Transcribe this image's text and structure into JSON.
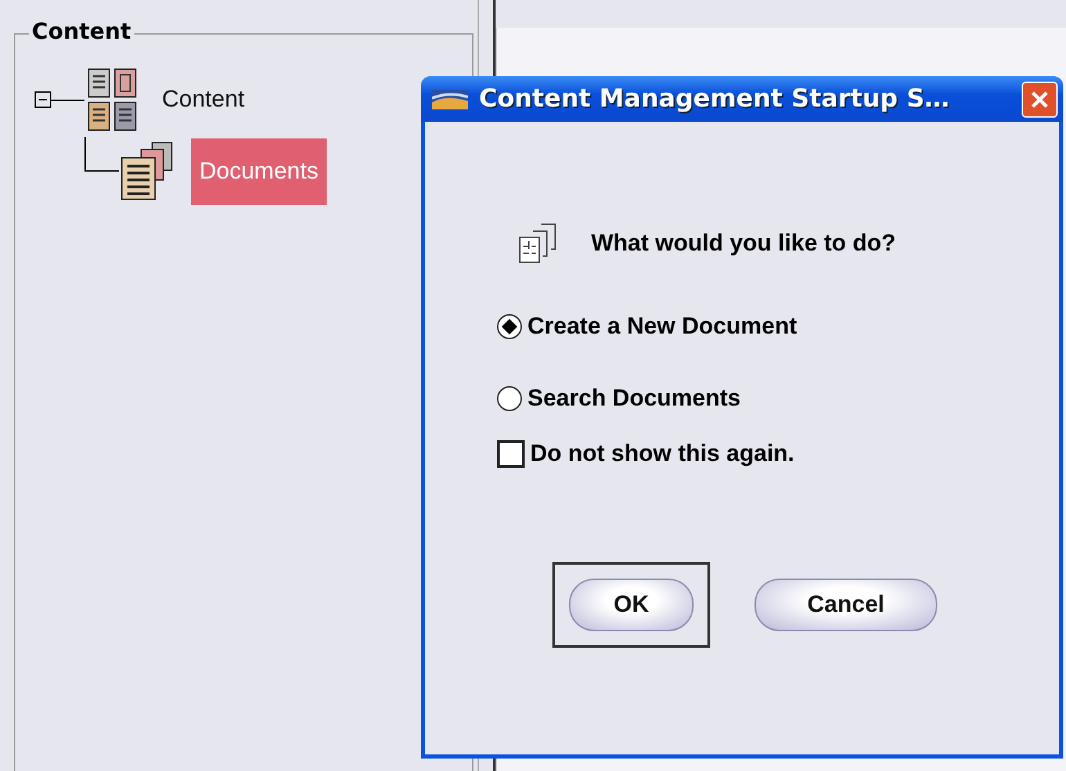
{
  "panel": {
    "title": "Content"
  },
  "tree": [
    {
      "label": "Content",
      "expanded": true,
      "selected": false,
      "children": [
        {
          "label": "Documents",
          "selected": true
        }
      ]
    }
  ],
  "dialog": {
    "title": "Content Management Startup S…",
    "question": "What would you like to do?",
    "options": [
      {
        "kind": "radio",
        "label": "Create a New Document",
        "selected": true
      },
      {
        "kind": "radio",
        "label": "Search Documents",
        "selected": false
      },
      {
        "kind": "checkbox",
        "label": "Do not show this again.",
        "checked": false
      }
    ],
    "buttons": [
      {
        "label": "OK",
        "focused": true
      },
      {
        "label": "Cancel",
        "focused": false
      }
    ]
  }
}
